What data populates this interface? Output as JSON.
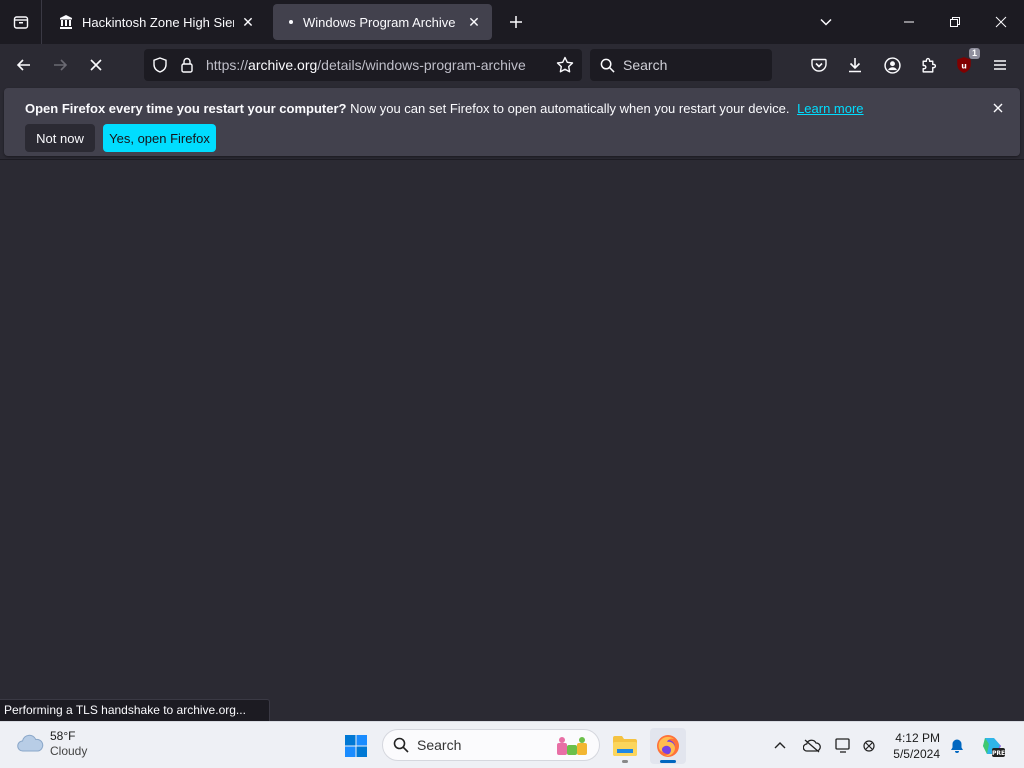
{
  "browser": {
    "tabs": [
      {
        "title": "Hackintosh Zone High Sierra Ir",
        "icon": "archive-building-icon",
        "active": false
      },
      {
        "title": "Windows Program Archive : Nc",
        "icon": "loading-dot-icon",
        "active": true
      }
    ],
    "url": {
      "prefix": "https://",
      "domain": "archive.org",
      "path": "/details/windows-program-archive"
    },
    "search_placeholder": "Search",
    "extension_badge": "1"
  },
  "notification": {
    "bold": "Open Firefox every time you restart your computer?",
    "message": "Now you can set Firefox to open automatically when you restart your device.",
    "link": "Learn more",
    "not_now": "Not now",
    "yes": "Yes, open Firefox"
  },
  "status": "Performing a TLS handshake to archive.org...",
  "taskbar": {
    "weather_temp": "58°F",
    "weather_cond": "Cloudy",
    "search_label": "Search",
    "time": "4:12 PM",
    "date": "5/5/2024"
  },
  "colors": {
    "accent": "#00ddff",
    "toolbar": "#2b2a33",
    "tabstrip": "#1c1b22",
    "notification_bg": "#42414d"
  }
}
